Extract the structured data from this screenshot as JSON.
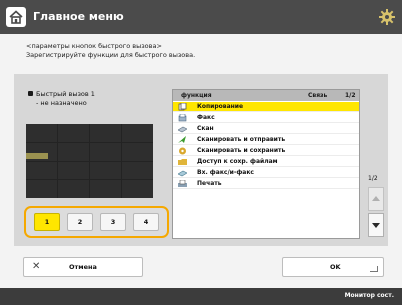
{
  "header": {
    "title": "Главное меню",
    "home_icon": "home-icon",
    "settings_icon": "gear-icon"
  },
  "instructions": {
    "line1": "<параметры кнопок быстрого вызова>",
    "line2": "Зарегистрируйте функции для быстрого вызова."
  },
  "quick_access": {
    "title": "Быстрый вызов 1",
    "status": "- не назначено"
  },
  "number_buttons": [
    {
      "label": "1",
      "selected": true
    },
    {
      "label": "2",
      "selected": false
    },
    {
      "label": "3",
      "selected": false
    },
    {
      "label": "4",
      "selected": false
    }
  ],
  "list": {
    "header_name": "функция",
    "header_col2": "Связь",
    "header_col3": "1/2",
    "items": [
      {
        "label": "Копирование",
        "icon": "copy-icon",
        "selected": true
      },
      {
        "label": "Факс",
        "icon": "fax-icon",
        "selected": false
      },
      {
        "label": "Скан",
        "icon": "scan-icon",
        "selected": false
      },
      {
        "label": "Сканировать и отправить",
        "icon": "send-icon",
        "selected": false
      },
      {
        "label": "Сканировать и сохранить",
        "icon": "save-icon",
        "selected": false
      },
      {
        "label": "Доступ к сохр. файлам",
        "icon": "folder-icon",
        "selected": false
      },
      {
        "label": "Вх. факс/и-факс",
        "icon": "inbox-icon",
        "selected": false
      },
      {
        "label": "Печать",
        "icon": "print-icon",
        "selected": false
      }
    ]
  },
  "scroll": {
    "page": "1/2"
  },
  "buttons": {
    "cancel": "Отмена",
    "ok": "OK"
  },
  "status_bar": {
    "text": "Монитор сост."
  },
  "colors": {
    "accent": "#ffe600",
    "highlight_border": "#f5a800",
    "header_bg": "#4b4b4b"
  }
}
